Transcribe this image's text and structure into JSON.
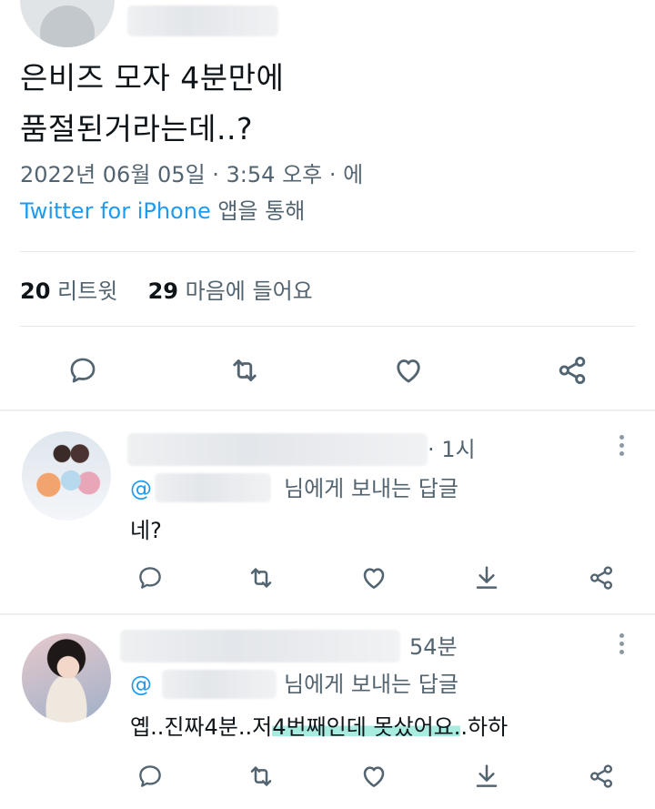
{
  "tweet": {
    "text_line1": "은비즈 모자 4분만에",
    "text_line2": "품절된거라는데..?",
    "datetime": "2022년 06월 05일 · 3:54 오후 · 에",
    "source": "Twitter for iPhone",
    "source_suffix": " 앱을 통해",
    "retweet_count": "20",
    "retweet_label": "리트윗",
    "like_count": "29",
    "like_label": "마음에 들어요"
  },
  "replies": [
    {
      "time": "· 1시",
      "mention_prefix": "@",
      "reply_to_label": "님에게 보내는 답글",
      "text": "네?"
    },
    {
      "time": "54분",
      "mention_prefix": "@",
      "reply_to_label": "님에게 보내는 답글",
      "text_part1": "옙..진짜4분..저",
      "text_highlight": "4번째인데 못샀어요.",
      "text_part2": ".하하"
    }
  ],
  "icons": {
    "reply": "comment-bubble-icon",
    "retweet": "retweet-icon",
    "like": "heart-icon",
    "share": "share-nodes-icon",
    "download": "download-arrow-icon",
    "more": "vertical-dots-icon"
  },
  "colors": {
    "link": "#1d9bf0",
    "secondary_text": "#536471",
    "icon": "#536471",
    "highlight": "#a8ece0"
  }
}
